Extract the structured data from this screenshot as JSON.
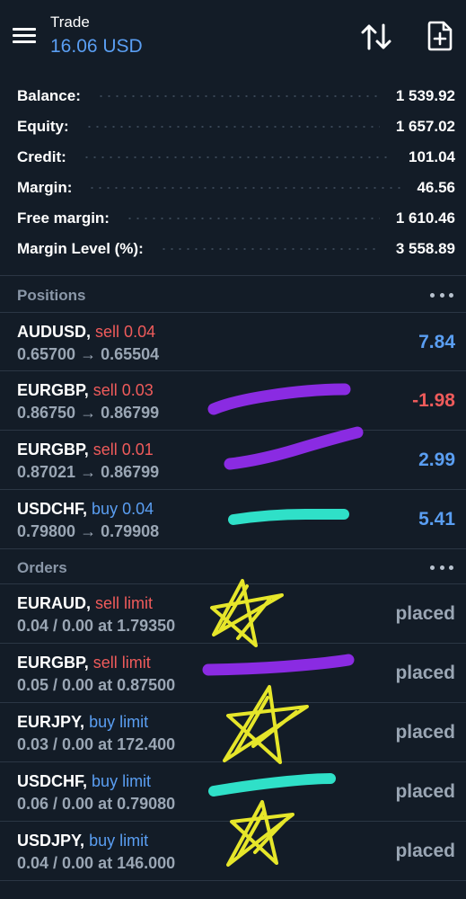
{
  "header": {
    "title": "Trade",
    "subtitle": "16.06 USD"
  },
  "summary": [
    {
      "label": "Balance:",
      "value": "1 539.92"
    },
    {
      "label": "Equity:",
      "value": "1 657.02"
    },
    {
      "label": "Credit:",
      "value": "101.04"
    },
    {
      "label": "Margin:",
      "value": "46.56"
    },
    {
      "label": "Free margin:",
      "value": "1 610.46"
    },
    {
      "label": "Margin Level (%):",
      "value": "3 558.89"
    }
  ],
  "positions": {
    "title": "Positions",
    "items": [
      {
        "symbol": "AUDUSD",
        "separator": ",",
        "action": "sell 0.04",
        "prices": "0.65700 → 0.65504",
        "profit": "7.84"
      },
      {
        "symbol": "EURGBP",
        "separator": ",",
        "action": "sell 0.03",
        "prices": "0.86750 → 0.86799",
        "profit": "-1.98"
      },
      {
        "symbol": "EURGBP",
        "separator": ",",
        "action": "sell 0.01",
        "prices": "0.87021 → 0.86799",
        "profit": "2.99"
      },
      {
        "symbol": "USDCHF",
        "separator": ",",
        "action": "buy 0.04",
        "prices": "0.79800 → 0.79908",
        "profit": "5.41"
      }
    ]
  },
  "orders": {
    "title": "Orders",
    "items": [
      {
        "symbol": "EURAUD",
        "separator": ",",
        "action": "sell limit",
        "details": "0.04 / 0.00 at 1.79350",
        "status": "placed"
      },
      {
        "symbol": "EURGBP",
        "separator": ",",
        "action": "sell limit",
        "details": "0.05 / 0.00 at 0.87500",
        "status": "placed"
      },
      {
        "symbol": "EURJPY",
        "separator": ",",
        "action": "buy limit",
        "details": "0.03 / 0.00 at 172.400",
        "status": "placed"
      },
      {
        "symbol": "USDCHF",
        "separator": ",",
        "action": "buy limit",
        "details": "0.06 / 0.00 at 0.79080",
        "status": "placed"
      },
      {
        "symbol": "USDJPY",
        "separator": ",",
        "action": "buy limit",
        "details": "0.04 / 0.00 at 146.000",
        "status": "placed"
      }
    ]
  },
  "icons": {
    "menu": "hamburger-menu-icon",
    "sort": "sort-arrows-icon",
    "new_order": "new-document-icon",
    "more": "more-dots-icon"
  },
  "colors": {
    "background": "#131c27",
    "accent_blue": "#5a9ef2",
    "sell_red": "#ef5b5b",
    "muted_text": "#9aa6b4",
    "scribble_purple": "#8a2be2",
    "scribble_teal": "#2fe0c8",
    "scribble_yellow": "#e6e62a"
  }
}
